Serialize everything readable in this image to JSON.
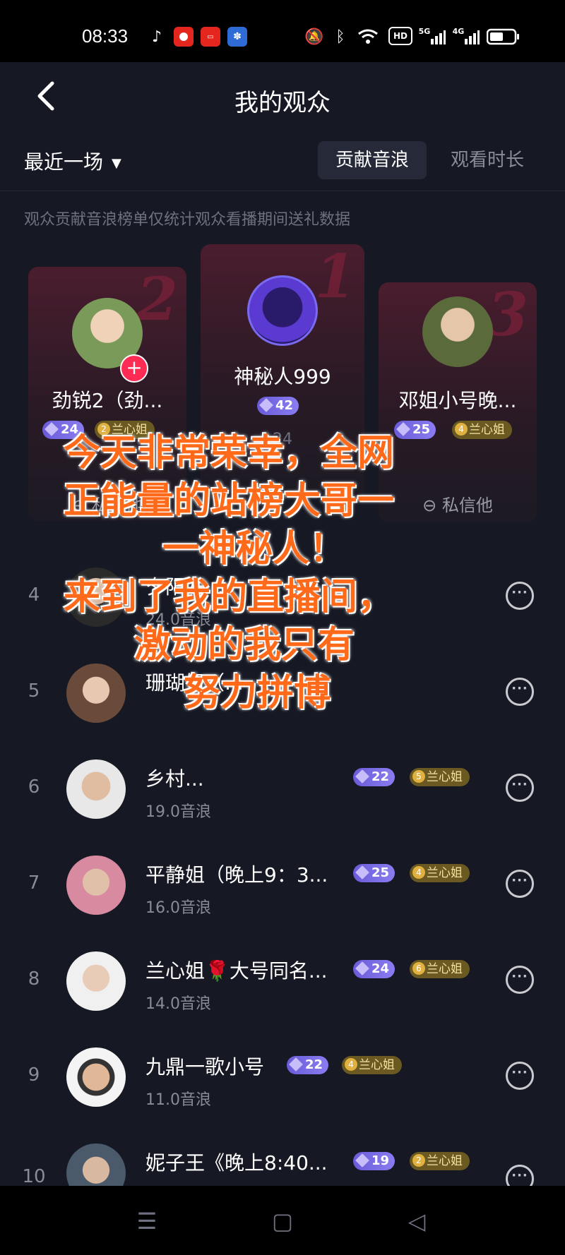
{
  "status_bar": {
    "time": "08:33",
    "icons": [
      "tiktok-icon",
      "app-icon-red",
      "toutiao-icon",
      "baidu-icon",
      "mute-icon",
      "bluetooth-icon",
      "wifi-icon",
      "hd-icon",
      "signal-5g-icon",
      "signal-4g-icon",
      "battery-icon"
    ],
    "hd_label": "HD",
    "net1": "5G",
    "net2": "4G"
  },
  "header": {
    "title": "我的观众"
  },
  "filter": {
    "label": "最近一场"
  },
  "tabs": [
    {
      "label": "贡献音浪",
      "active": true
    },
    {
      "label": "观看时长",
      "active": false
    }
  ],
  "note": "观众贡献音浪榜单仅统计观众看播期间送礼数据",
  "podium": [
    {
      "rank": "1",
      "name": "神秘人999",
      "level": "42",
      "sub": "24"
    },
    {
      "rank": "2",
      "name": "劲锐2（劲...",
      "level": "24",
      "fan_level": "2",
      "fan_club": "兰心姐",
      "msg": "私信他"
    },
    {
      "rank": "3",
      "name": "邓姐小号晚...",
      "level": "25",
      "fan_level": "4",
      "fan_club": "兰心姐",
      "msg": "私信他"
    }
  ],
  "list": [
    {
      "rank": "4",
      "name": "夕阳好...",
      "sub": "24.0音浪"
    },
    {
      "rank": "5",
      "name": "珊瑚姐（...",
      "sub": "",
      "fan_level": "",
      "fan_club": ""
    },
    {
      "rank": "6",
      "name": "乡村...",
      "sub": "19.0音浪",
      "level": "22",
      "fan_level": "5",
      "fan_club": "兰心姐"
    },
    {
      "rank": "7",
      "name": "平静姐（晚上9：3...",
      "sub": "16.0音浪",
      "level": "25",
      "fan_level": "4",
      "fan_club": "兰心姐"
    },
    {
      "rank": "8",
      "name": "兰心姐🌹大号同名...",
      "sub": "14.0音浪",
      "level": "24",
      "fan_level": "6",
      "fan_club": "兰心姐"
    },
    {
      "rank": "9",
      "name": "九鼎一歌小号",
      "sub": "11.0音浪",
      "level": "22",
      "fan_level": "4",
      "fan_club": "兰心姐"
    },
    {
      "rank": "10",
      "name": "妮子王《晚上8:40...",
      "sub": "",
      "level": "19",
      "fan_level": "2",
      "fan_club": "兰心姐"
    }
  ],
  "overlay_text": {
    "line1": "今天非常荣幸，全网",
    "line2": "正能量的站榜大哥一",
    "line3": "一神秘人！",
    "line4": "来到了我的直播间，",
    "line5": "激动的我只有",
    "line6": "努力拼博"
  },
  "colors": {
    "background": "#161823",
    "accent": "#fe2c55",
    "overlay": "#ff6a1a"
  }
}
